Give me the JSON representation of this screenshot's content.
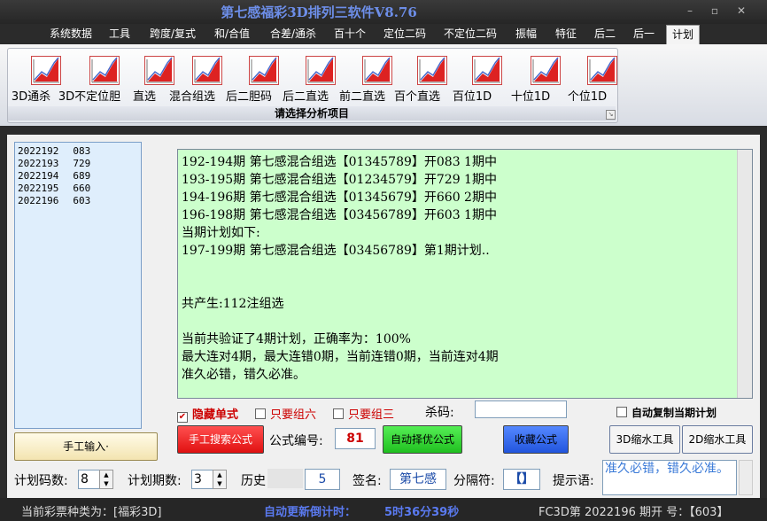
{
  "window": {
    "title": "第七感福彩3D排列三软件V8.76",
    "minimize": "–",
    "maximize": "▫",
    "close": "✕"
  },
  "menu": [
    "系统数据",
    "工具",
    "跨度/复式",
    "和/合值",
    "合差/通杀",
    "百十个",
    "定位二码",
    "不定位二码",
    "振幅",
    "特征",
    "后二",
    "后一",
    "计划"
  ],
  "ribbon": {
    "buttons": [
      "3D通杀",
      "3D不定位胆",
      "直选",
      "混合组选",
      "后二胆码",
      "后二直选",
      "前二直选",
      "百个直选",
      "百位1D",
      "十位1D",
      "个位1D"
    ],
    "caption": "请选择分析项目"
  },
  "history": [
    {
      "period": "2022192",
      "num": "083"
    },
    {
      "period": "2022193",
      "num": "729"
    },
    {
      "period": "2022194",
      "num": "689"
    },
    {
      "period": "2022195",
      "num": "660"
    },
    {
      "period": "2022196",
      "num": "603"
    }
  ],
  "manual_input": "手工输入·",
  "output_lines": [
    "192-194期 第七感混合组选【01345789】开083 1期中",
    "193-195期 第七感混合组选【01234579】开729 1期中",
    "194-196期 第七感混合组选【01345679】开660 2期中",
    "196-198期 第七感混合组选【03456789】开603 1期中",
    "当期计划如下:",
    "197-199期 第七感混合组选【03456789】第1期计划..",
    "",
    "",
    "共产生:112注组选",
    "",
    "当前共验证了4期计划，正确率为：100%",
    "最大连对4期，最大连错0期，当前连错0期，当前连对4期",
    "准久必错，错久必准。"
  ],
  "options": {
    "hide_single": "隐藏单式",
    "only_g6": "只要组六",
    "only_g3": "只要组三",
    "kill_code_label": "杀码:",
    "kill_code": "",
    "auto_copy": "自动复制当期计划",
    "check_mark": "✔"
  },
  "controls": {
    "manual_search": "手工搜索公式",
    "formula_no_label": "公式编号:",
    "formula_no": "81",
    "auto_optimize": "自动择优公式",
    "favorite": "收藏公式",
    "shrink3d": "3D缩水工具",
    "shrink2d": "2D缩水工具"
  },
  "bottom": {
    "plan_codes_label": "计划码数:",
    "plan_codes": "8",
    "plan_periods_label": "计划期数:",
    "plan_periods": "3",
    "history_label": "历史",
    "history_val": "5",
    "sign_label": "签名:",
    "sign": "第七感",
    "sep_label": "分隔符:",
    "sep": "【】",
    "hint_label": "提示语:",
    "hint": "准久必错，错久必准。"
  },
  "status": {
    "lottery": "当前彩票种类为：[福彩3D]",
    "countdown_label": "自动更新倒计时：",
    "countdown": "5时36分39秒",
    "draw": "FC3D第 2022196 期开 号：【603】"
  },
  "colors": {
    "output_bg": "#ccffcc",
    "accent": "#6d8ee8",
    "red_btn": "#ee2020",
    "green_btn": "#22cc22",
    "blue_btn": "#3366ee"
  }
}
